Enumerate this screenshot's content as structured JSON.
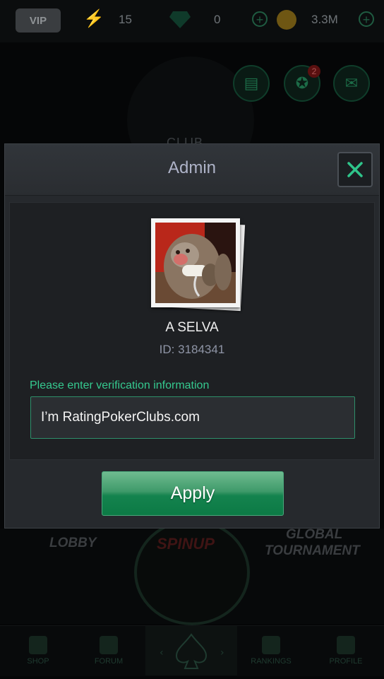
{
  "topbar": {
    "vip_label": "VIP",
    "energy": "15",
    "gems": "0",
    "coins": "3.3M"
  },
  "background": {
    "club_label": "CLUB",
    "mail_badge": "2",
    "modes": [
      "LOBBY",
      "SPINUP",
      "GLOBAL",
      "TOURNAMENT"
    ],
    "tabs": [
      "SHOP",
      "FORUM",
      "",
      "RANKINGS",
      "PROFILE"
    ]
  },
  "dialog": {
    "title": "Admin",
    "user": {
      "name": "A SELVA",
      "id": "ID: 3184341"
    },
    "verify_label": "Please enter verification information",
    "verify_value": "I’m RatingPokerClubs.com",
    "apply_label": "Apply"
  },
  "colors": {
    "accent_green": "#35c98f",
    "button_green": "#14834e",
    "dialog_bg": "#26292d"
  },
  "icons": [
    "lightning-icon",
    "gem-icon",
    "coin-icon",
    "plus-icon",
    "calendar-icon",
    "award-icon",
    "mail-icon",
    "close-icon",
    "spade-icon"
  ]
}
